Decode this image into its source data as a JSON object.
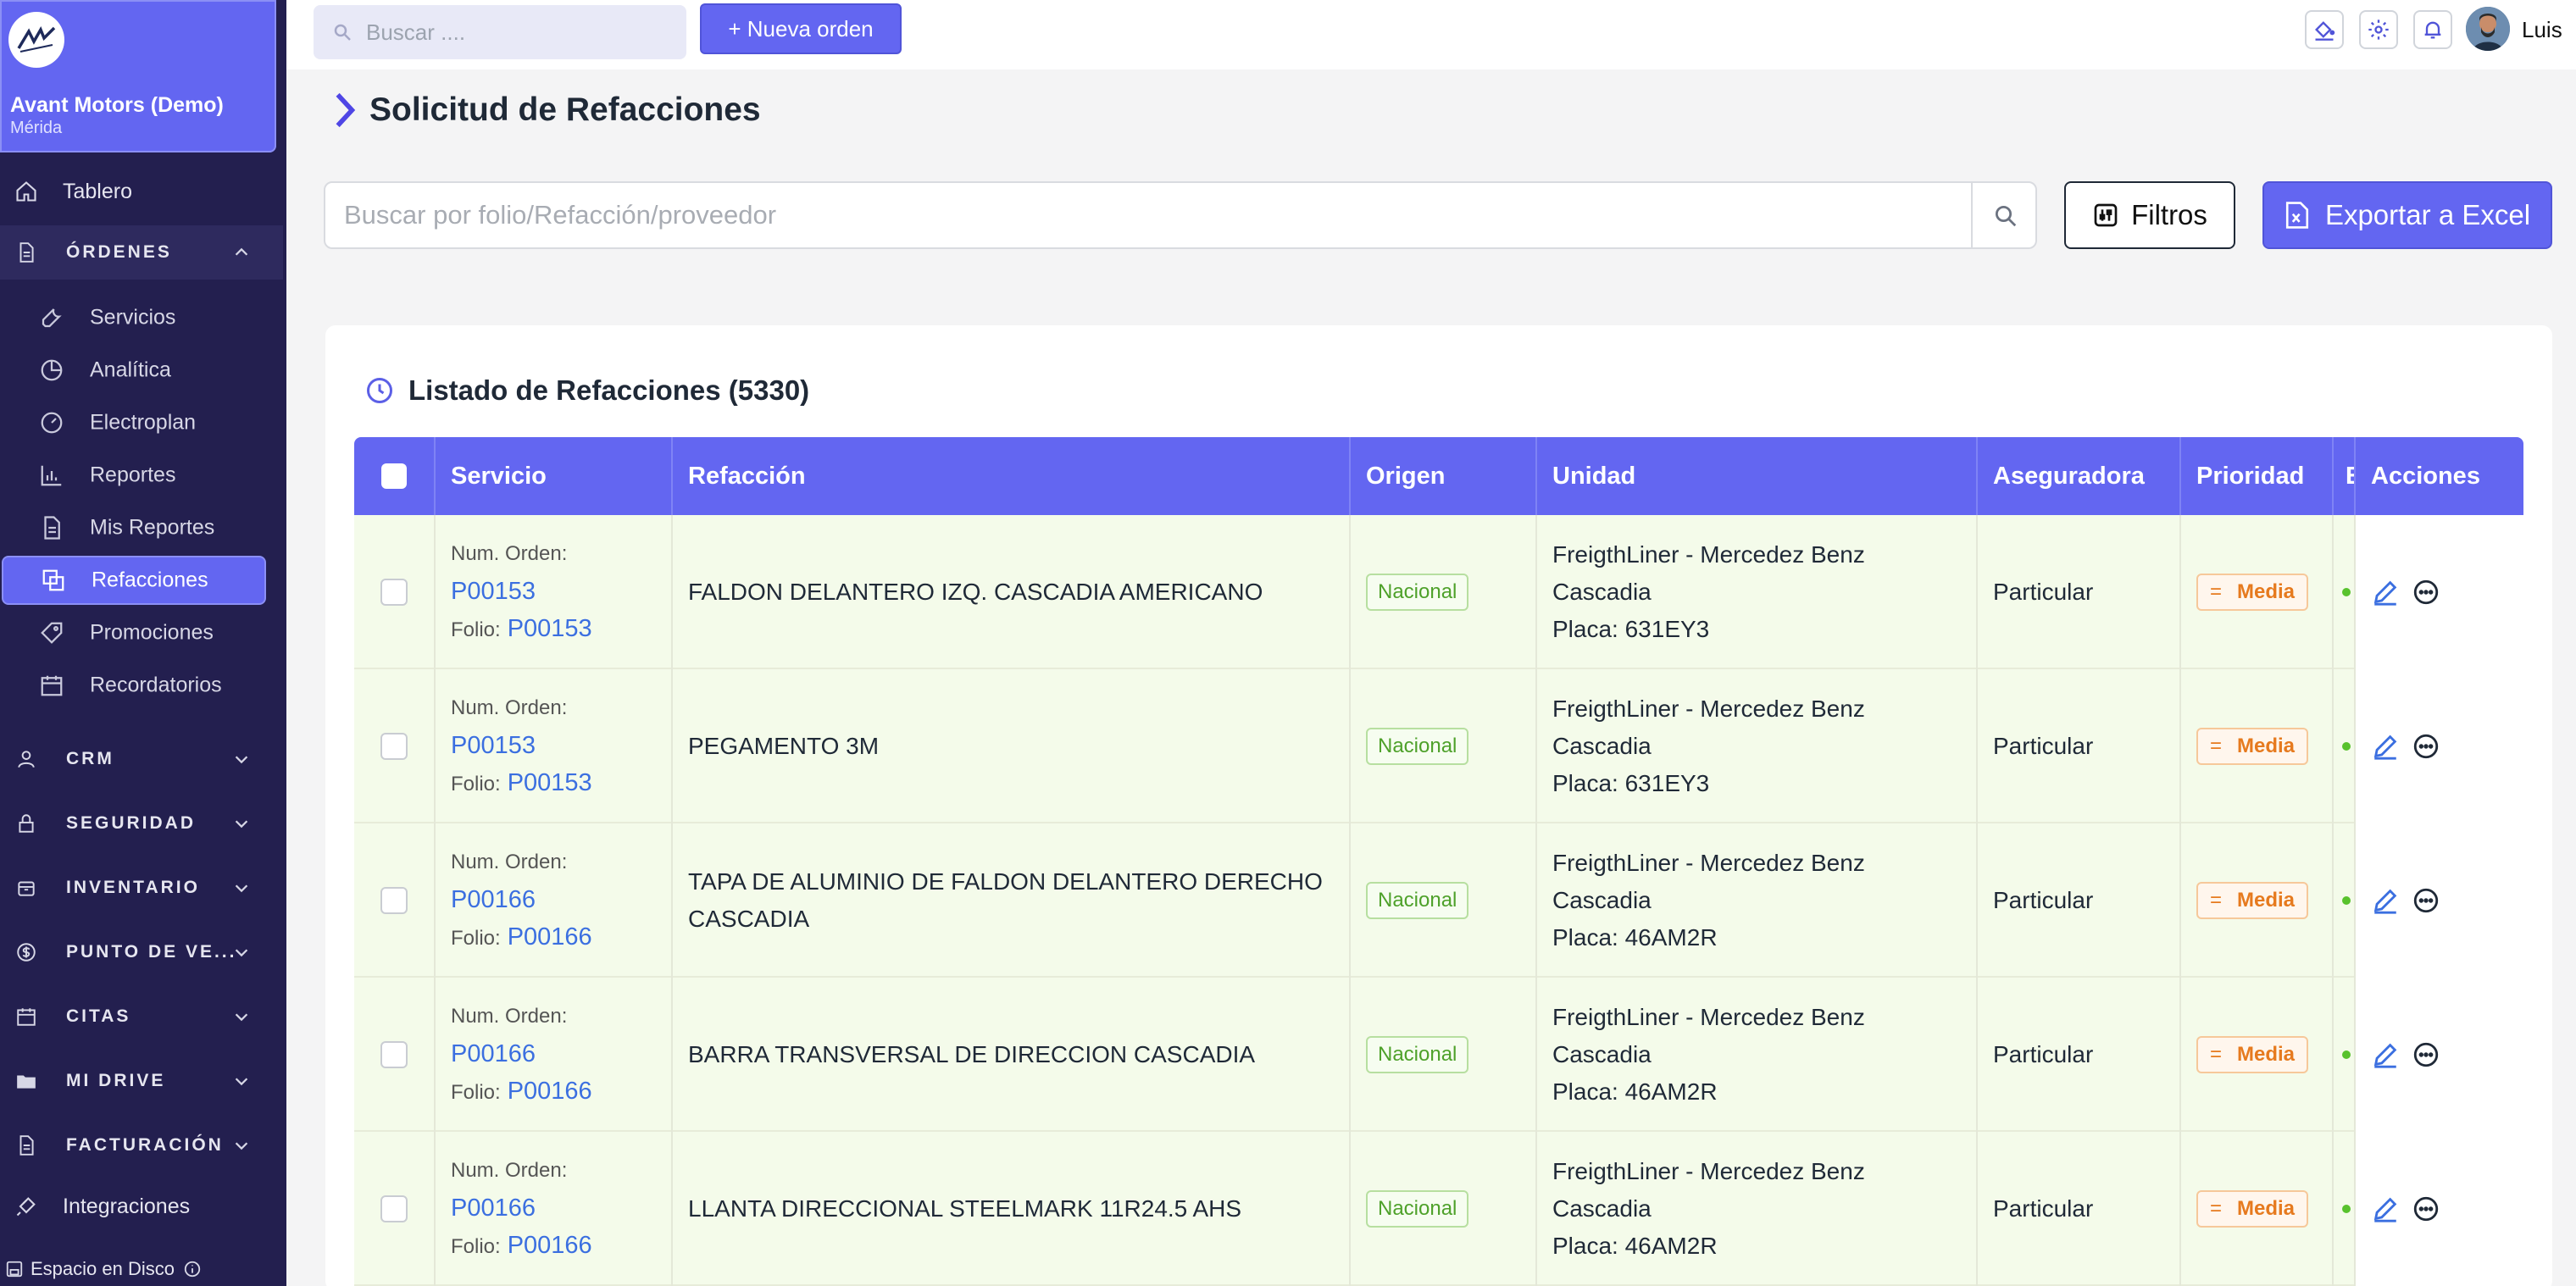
{
  "org": {
    "name": "Avant Motors (Demo)",
    "city": "Mérida"
  },
  "sidebar": {
    "tablero": "Tablero",
    "ordenes": "ÓRDENES",
    "sub": [
      "Servicios",
      "Analítica",
      "Electroplan",
      "Reportes",
      "Mis Reportes",
      "Refacciones",
      "Promociones",
      "Recordatorios"
    ],
    "sections": [
      "CRM",
      "SEGURIDAD",
      "INVENTARIO",
      "PUNTO DE VE...",
      "CITAS",
      "MI DRIVE",
      "FACTURACIÓN"
    ],
    "integraciones": "Integraciones",
    "disk": "Espacio en Disco"
  },
  "topbar": {
    "search_placeholder": "Buscar ....",
    "new_order": "+ Nueva orden",
    "user": "Luis"
  },
  "main": {
    "title": "Solicitud de Refacciones",
    "search_placeholder": "Buscar por folio/Refacción/proveedor",
    "filtros": "Filtros",
    "excel": "Exportar a Excel",
    "list_title": "Listado de Refacciones (5330)"
  },
  "table": {
    "headers": [
      "Servicio",
      "Refacción",
      "Origen",
      "Unidad",
      "Aseguradora",
      "Prioridad",
      "E",
      "Acciones"
    ],
    "num_orden_label": "Num. Orden:",
    "folio_label": "Folio:",
    "rows": [
      {
        "orden": "P00153",
        "folio": "P00153",
        "refaccion_1": "FALDON DELANTERO IZQ. CASCADIA AMERICANO",
        "refaccion_2": "",
        "origen": "Nacional",
        "unidad_1": "FreigthLiner - Mercedez Benz",
        "unidad_2": "Cascadia",
        "unidad_3": "Placa: 631EY3",
        "aseguradora": "Particular",
        "prioridad": "Media"
      },
      {
        "orden": "P00153",
        "folio": "P00153",
        "refaccion_1": "PEGAMENTO 3M",
        "refaccion_2": "",
        "origen": "Nacional",
        "unidad_1": "FreigthLiner - Mercedez Benz",
        "unidad_2": "Cascadia",
        "unidad_3": "Placa: 631EY3",
        "aseguradora": "Particular",
        "prioridad": "Media"
      },
      {
        "orden": "P00166",
        "folio": "P00166",
        "refaccion_1": "TAPA DE ALUMINIO DE FALDON DELANTERO DERECHO",
        "refaccion_2": "CASCADIA",
        "origen": "Nacional",
        "unidad_1": "FreigthLiner - Mercedez Benz",
        "unidad_2": "Cascadia",
        "unidad_3": "Placa: 46AM2R",
        "aseguradora": "Particular",
        "prioridad": "Media"
      },
      {
        "orden": "P00166",
        "folio": "P00166",
        "refaccion_1": "BARRA TRANSVERSAL DE DIRECCION CASCADIA",
        "refaccion_2": "",
        "origen": "Nacional",
        "unidad_1": "FreigthLiner - Mercedez Benz",
        "unidad_2": "Cascadia",
        "unidad_3": "Placa: 46AM2R",
        "aseguradora": "Particular",
        "prioridad": "Media"
      },
      {
        "orden": "P00166",
        "folio": "P00166",
        "refaccion_1": "LLANTA DIRECCIONAL STEELMARK 11R24.5 AHS",
        "refaccion_2": "",
        "origen": "Nacional",
        "unidad_1": "FreigthLiner - Mercedez Benz",
        "unidad_2": "Cascadia",
        "unidad_3": "Placa: 46AM2R",
        "aseguradora": "Particular",
        "prioridad": "Media"
      }
    ]
  },
  "colors": {
    "accent": "#6366f1",
    "sidebar": "#231f4f",
    "row_bg": "#f4fbea",
    "link": "#3b6fe0"
  }
}
